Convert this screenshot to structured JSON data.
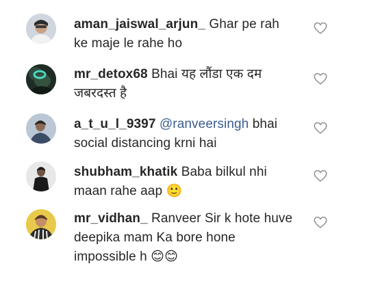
{
  "comments": [
    {
      "username": "aman_jaiswal_arjun_",
      "mention": "",
      "text": "Ghar pe rah ke maje le rahe ho",
      "avatar_icon": "user-avatar",
      "like_icon": "heart-outline-icon"
    },
    {
      "username": "mr_detox68",
      "mention": "",
      "text": "Bhai यह लौंडा एक दम जबरदस्त है",
      "avatar_icon": "user-avatar",
      "like_icon": "heart-outline-icon"
    },
    {
      "username": "a_t_u_l_9397",
      "mention": "@ranveersingh",
      "text": "bhai social distancing krni hai",
      "avatar_icon": "user-avatar",
      "like_icon": "heart-outline-icon"
    },
    {
      "username": "shubham_khatik",
      "mention": "",
      "text": "Baba bilkul nhi maan rahe aap 🙂",
      "avatar_icon": "user-avatar",
      "like_icon": "heart-outline-icon"
    },
    {
      "username": "mr_vidhan_",
      "mention": "",
      "text": "Ranveer Sir k hote huve deepika mam Ka bore hone impossible h 😊😊",
      "avatar_icon": "user-avatar",
      "like_icon": "heart-outline-icon"
    }
  ],
  "colors": {
    "text": "#262626",
    "mention": "#3a5d8f",
    "heart_outline": "#8e8e8e"
  }
}
